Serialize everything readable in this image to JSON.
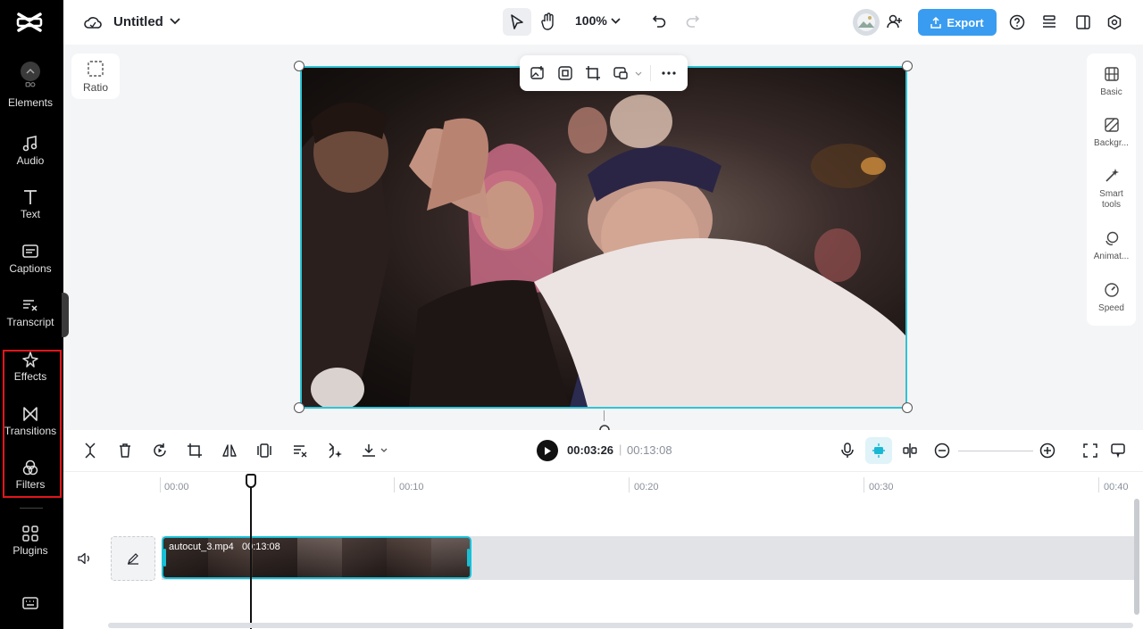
{
  "sidebar": {
    "items": [
      {
        "label": "Elements"
      },
      {
        "label": "Audio"
      },
      {
        "label": "Text"
      },
      {
        "label": "Captions"
      },
      {
        "label": "Transcript"
      },
      {
        "label": "Effects"
      },
      {
        "label": "Transitions"
      },
      {
        "label": "Filters"
      },
      {
        "label": "Plugins"
      }
    ]
  },
  "topbar": {
    "title": "Untitled",
    "zoom": "100%",
    "export_label": "Export"
  },
  "canvas": {
    "ratio_label": "Ratio"
  },
  "right_panel": {
    "items": [
      {
        "label": "Basic"
      },
      {
        "label": "Backgr..."
      },
      {
        "label": "Smart tools"
      },
      {
        "label": "Animat..."
      },
      {
        "label": "Speed"
      }
    ]
  },
  "timeline_toolbar": {
    "current_time": "00:03:26",
    "separator": "|",
    "total_time": "00:13:08"
  },
  "timeline": {
    "ticks": [
      "00:00",
      "00:10",
      "00:20",
      "00:30",
      "00:40"
    ],
    "clip": {
      "filename": "autocut_3.mp4",
      "duration": "00:13:08"
    }
  },
  "colors": {
    "accent": "#3a9cf0",
    "selection": "#2ec4d6",
    "highlight_box": "#e0161b",
    "sidebar_bg": "#000000"
  }
}
